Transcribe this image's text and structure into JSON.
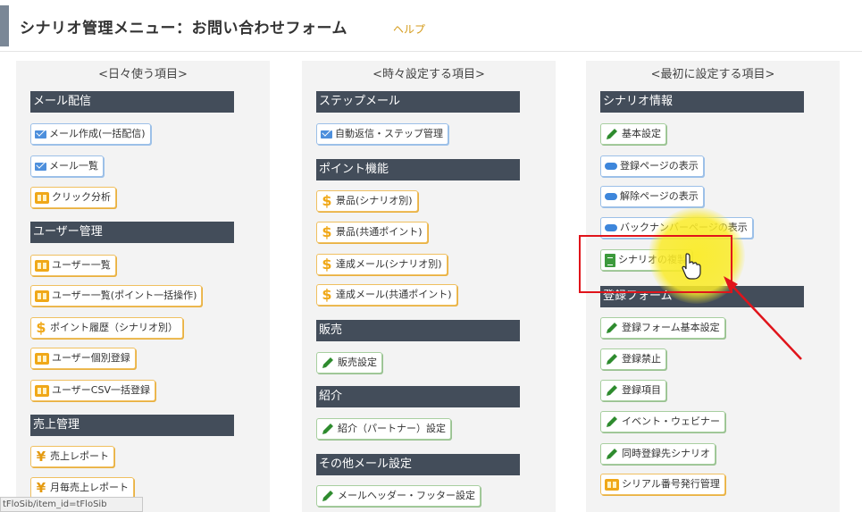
{
  "header": {
    "title": "シナリオ管理メニュー：お問い合わせフォーム",
    "help": "ヘルプ"
  },
  "columns": [
    {
      "title": "<日々使う項目>",
      "sections": [
        {
          "label": "メール配信"
        },
        {
          "label": "ユーザー管理"
        },
        {
          "label": "売上管理"
        }
      ],
      "buttons": [
        {
          "label": "メール作成(一括配信)",
          "icon": "mail-icon"
        },
        {
          "label": "メール一覧",
          "icon": "mail-icon"
        },
        {
          "label": "クリック分析",
          "icon": "bag-icon"
        },
        {
          "label": "ユーザー一覧",
          "icon": "bag-icon"
        },
        {
          "label": "ユーザー一覧(ポイント一括操作)",
          "icon": "bag-icon"
        },
        {
          "label": "ポイント履歴（シナリオ別）",
          "icon": "dollar-icon"
        },
        {
          "label": "ユーザー個別登録",
          "icon": "bag-icon"
        },
        {
          "label": "ユーザーCSV一括登録",
          "icon": "bag-icon"
        },
        {
          "label": "売上レポート",
          "icon": "yen-icon"
        },
        {
          "label": "月毎売上レポート",
          "icon": "yen-icon"
        }
      ]
    },
    {
      "title": "<時々設定する項目>",
      "sections": [
        {
          "label": "ステップメール"
        },
        {
          "label": "ポイント機能"
        },
        {
          "label": "販売"
        },
        {
          "label": "紹介"
        },
        {
          "label": "その他メール設定"
        }
      ],
      "buttons": [
        {
          "label": "自動返信・ステップ管理",
          "icon": "mail-icon"
        },
        {
          "label": "景品(シナリオ別)",
          "icon": "dollar-icon"
        },
        {
          "label": "景品(共通ポイント)",
          "icon": "dollar-icon"
        },
        {
          "label": "達成メール(シナリオ別)",
          "icon": "dollar-icon"
        },
        {
          "label": "達成メール(共通ポイント)",
          "icon": "dollar-icon"
        },
        {
          "label": "販売設定",
          "icon": "pencil-icon"
        },
        {
          "label": "紹介（パートナー）設定",
          "icon": "pencil-icon"
        },
        {
          "label": "メールヘッダー・フッター設定",
          "icon": "pencil-icon"
        }
      ]
    },
    {
      "title": "<最初に設定する項目>",
      "sections": [
        {
          "label": "シナリオ情報"
        },
        {
          "label": "登録フォーム"
        }
      ],
      "buttons": [
        {
          "label": "基本設定",
          "icon": "pencil-icon"
        },
        {
          "label": "登録ページの表示",
          "icon": "arrow-icon"
        },
        {
          "label": "解除ページの表示",
          "icon": "arrow-icon"
        },
        {
          "label": "バックナンバーページの表示",
          "icon": "arrow-icon"
        },
        {
          "label": "シナリオの複製",
          "icon": "document-icon"
        },
        {
          "label": "登録フォーム基本設定",
          "icon": "pencil-icon"
        },
        {
          "label": "登録禁止",
          "icon": "pencil-icon"
        },
        {
          "label": "登録項目",
          "icon": "pencil-icon"
        },
        {
          "label": "イベント・ウェビナー",
          "icon": "pencil-icon"
        },
        {
          "label": "同時登録先シナリオ",
          "icon": "pencil-icon"
        },
        {
          "label": "シリアル番号発行管理",
          "icon": "bag-icon"
        }
      ]
    }
  ],
  "status_tip": "tFloSib/item_id=tFloSib",
  "colors": {
    "section_bg": "#434d5a",
    "highlight_box": "#e0141b",
    "cursor_highlight": "#faeb28",
    "help_link": "#d49a18"
  }
}
